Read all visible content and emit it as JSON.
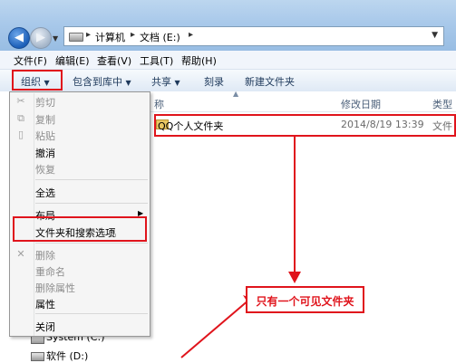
{
  "address": {
    "crumbs": [
      "计算机",
      "文档 (E:)"
    ]
  },
  "menubar": [
    "文件(F)",
    "编辑(E)",
    "查看(V)",
    "工具(T)",
    "帮助(H)"
  ],
  "toolbar": [
    "组织",
    "包含到库中",
    "共享",
    "刻录",
    "新建文件夹"
  ],
  "columns": {
    "name_partial": "称",
    "date": "修改日期",
    "type": "类型"
  },
  "file": {
    "name": "QQ个人文件夹",
    "date": "2014/8/19 13:39",
    "type": "文件"
  },
  "context_menu": {
    "cut": "剪切",
    "copy": "复制",
    "paste": "粘贴",
    "undo": "撤消",
    "redo": "恢复",
    "select_all": "全选",
    "layout": "布局",
    "folder_options": "文件夹和搜索选项",
    "delete": "删除",
    "rename": "重命名",
    "remove_properties": "删除属性",
    "properties": "属性",
    "close": "关闭"
  },
  "navpane": {
    "system_drive": "System (C:)",
    "software_drive": "软件 (D:)"
  },
  "annotation": {
    "callout": "只有一个可见文件夹"
  },
  "colors": {
    "annotation_red": "#e0141c",
    "selection_blue": "#1e395b"
  }
}
